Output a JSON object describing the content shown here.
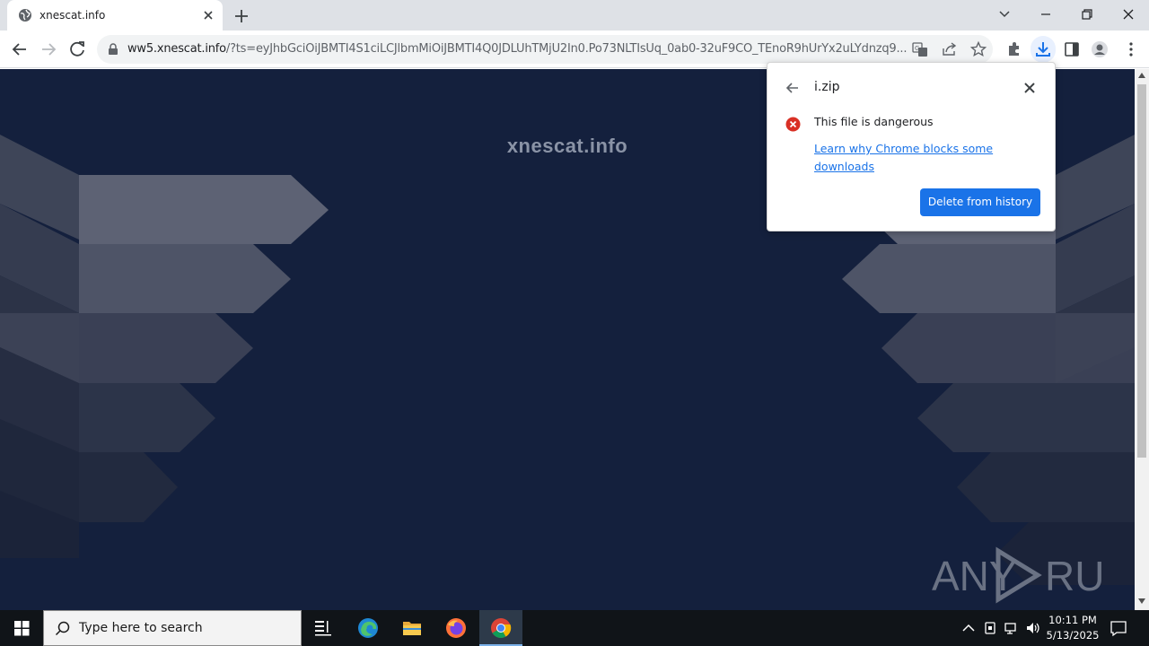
{
  "browser": {
    "tab": {
      "title": "xnescat.info"
    },
    "omnibox": {
      "url_host": "ww5.xnescat.info",
      "url_rest": "/?ts=eyJhbGciOiJBMTI4S1ciLCJlbmMiOiJBMTI4Q0JDLUhTMjU2In0.Po73NLTIsUq_0ab0-32uF9CO_TEnoR9hUrYx2uLYdnzq9..."
    }
  },
  "page": {
    "site_title": "xnescat.info",
    "background_color": "#14203d"
  },
  "download_bubble": {
    "filename": "i.zip",
    "status": "This file is dangerous",
    "learn_link": "Learn why Chrome blocks some downloads",
    "delete_button": "Delete from history"
  },
  "watermark": {
    "text": "ANY RUN"
  },
  "taskbar": {
    "search_placeholder": "Type here to search",
    "time": "10:11 PM",
    "date": "5/13/2025"
  }
}
